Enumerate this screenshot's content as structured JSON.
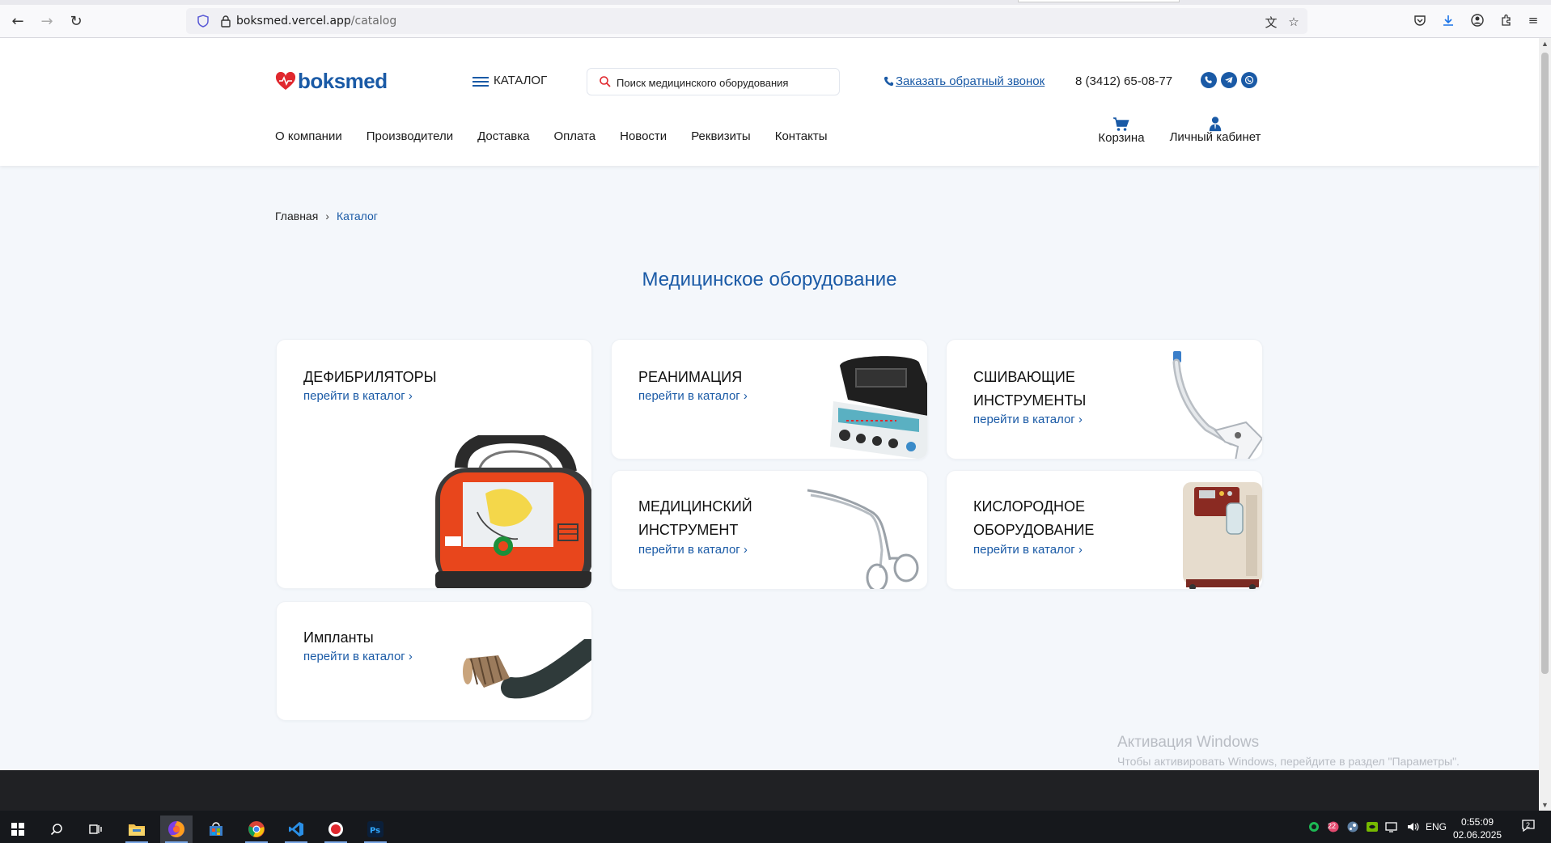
{
  "browser": {
    "url_host": "boksmed.vercel.app",
    "url_path": "/catalog"
  },
  "header": {
    "logo_text": "boksmed",
    "catalog_label": "КАТАЛОГ",
    "search_placeholder": "Поиск медицинского оборудования",
    "callback_label": "Заказать обратный звонок",
    "phone": "8 (3412) 65-08-77",
    "nav": [
      {
        "label": "О компании"
      },
      {
        "label": "Производители"
      },
      {
        "label": "Доставка"
      },
      {
        "label": "Оплата"
      },
      {
        "label": "Новости"
      },
      {
        "label": "Реквизиты"
      },
      {
        "label": "Контакты"
      }
    ],
    "cart_label": "Корзина",
    "cabinet_label": "Личный кабинет"
  },
  "breadcrumb": {
    "home": "Главная",
    "separator": "›",
    "current": "Каталог"
  },
  "page_title": "Медицинское оборудование",
  "cards": [
    {
      "title": "ДЕФИБРИЛЯТОРЫ",
      "link": "перейти в каталог ›"
    },
    {
      "title": "РЕАНИМАЦИЯ",
      "link": "перейти в каталог ›"
    },
    {
      "title": "СШИВАЮЩИЕ ИНСТРУМЕНТЫ",
      "link": "перейти в каталог ›"
    },
    {
      "title": "МЕДИЦИНСКИЙ ИНСТРУМЕНТ",
      "link": "перейти в каталог ›"
    },
    {
      "title": "КИСЛОРОДНОЕ ОБОРУДОВАНИЕ",
      "link": "перейти в каталог ›"
    },
    {
      "title": "Импланты",
      "link": "перейти в каталог ›"
    }
  ],
  "watermark": {
    "line1": "Активация Windows",
    "line2": "Чтобы активировать Windows, перейдите в раздел \"Параметры\"."
  },
  "taskbar": {
    "language": "ENG",
    "time": "0:55:09",
    "date": "02.06.2025",
    "notification_count": "2",
    "tray_badge": "22"
  },
  "colors": {
    "brand_blue": "#1a5aa6",
    "logo_red": "#e0282e",
    "page_bg": "#f4f7fb"
  }
}
